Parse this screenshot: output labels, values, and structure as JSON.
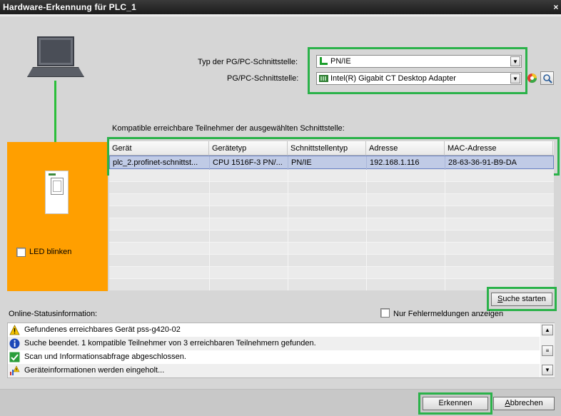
{
  "window": {
    "title": "Hardware-Erkennung für PLC_1",
    "close_glyph": "×"
  },
  "interface": {
    "type_label": "Typ der PG/PC-Schnittstelle:",
    "type_value": "PN/IE",
    "iface_label": "PG/PC-Schnittstelle:",
    "iface_value": "Intel(R) Gigabit CT Desktop Adapter"
  },
  "table": {
    "caption": "Kompatible erreichbare Teilnehmer der ausgewählten Schnittstelle:",
    "columns": [
      "Gerät",
      "Gerätetyp",
      "Schnittstellentyp",
      "Adresse",
      "MAC-Adresse"
    ],
    "rows": [
      [
        "plc_2.profinet-schnittst...",
        "CPU 1516F-3 PN/...",
        "PN/IE",
        "192.168.1.116",
        "28-63-36-91-B9-DA"
      ]
    ]
  },
  "led": {
    "label": "LED blinken"
  },
  "search": {
    "label": "Suche starten",
    "accesskey": "S",
    "rest": "uche starten"
  },
  "status": {
    "title": "Online-Statusinformation:",
    "only_errors_label": "Nur Fehlermeldungen anzeigen",
    "messages": [
      {
        "icon": "warning-icon",
        "text": "Gefundenes erreichbares Gerät pss-g420-02"
      },
      {
        "icon": "info-icon",
        "text": "Suche beendet. 1 kompatible Teilnehmer von 3 erreichbaren Teilnehmern gefunden."
      },
      {
        "icon": "checkmark-icon",
        "text": "Scan und Informationsabfrage abgeschlossen."
      },
      {
        "icon": "loading-info-icon",
        "text": "Geräteinformationen werden eingeholt..."
      }
    ]
  },
  "footer": {
    "detect_label": "Erkennen",
    "cancel_label": "Abbrechen",
    "cancel_key": "A",
    "cancel_rest": "bbrechen"
  },
  "colors": {
    "highlight": "#2bb24a",
    "orange": "#ff9f00",
    "selection": "#c0cbe6"
  }
}
